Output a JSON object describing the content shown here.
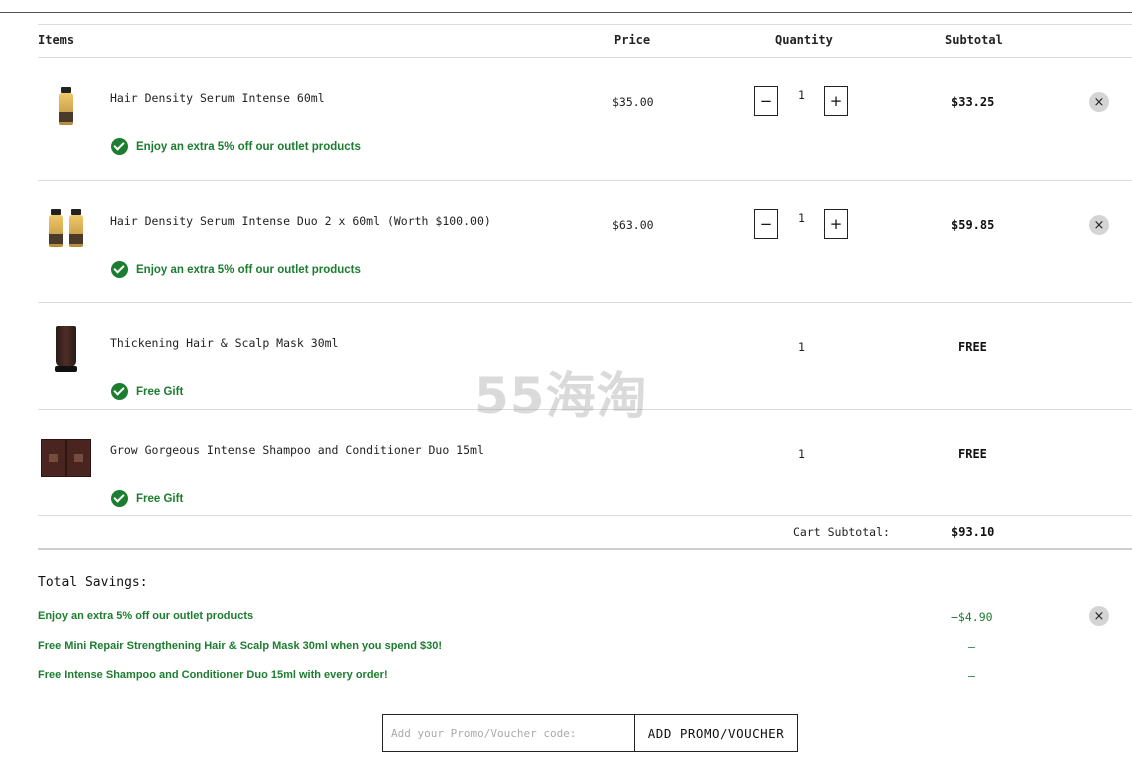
{
  "header": {
    "items": "Items",
    "price": "Price",
    "quantity": "Quantity",
    "subtotal": "Subtotal"
  },
  "items": [
    {
      "name": "Hair Density Serum Intense 60ml",
      "price": "$35.00",
      "quantity": "1",
      "subtotal": "$33.25",
      "promo": "Enjoy an extra 5% off our outlet products"
    },
    {
      "name": "Hair Density Serum Intense Duo 2 x 60ml (Worth $100.00)",
      "price": "$63.00",
      "quantity": "1",
      "subtotal": "$59.85",
      "promo": "Enjoy an extra 5% off our outlet products"
    },
    {
      "name": "Thickening Hair & Scalp Mask 30ml",
      "quantity": "1",
      "subtotal": "FREE",
      "promo": "Free Gift"
    },
    {
      "name": "Grow Gorgeous Intense Shampoo and Conditioner Duo 15ml",
      "quantity": "1",
      "subtotal": "FREE",
      "promo": "Free Gift"
    }
  ],
  "qty_controls": {
    "minus": "−",
    "plus": "+"
  },
  "remove_symbol": "×",
  "cart_subtotal": {
    "label": "Cart Subtotal:",
    "value": "$93.10"
  },
  "savings": {
    "title": "Total Savings:",
    "lines": [
      {
        "label": "Enjoy an extra 5% off our outlet products",
        "amount": "−$4.90"
      },
      {
        "label": "Free Mini Repair Strengthening Hair & Scalp Mask 30ml when you spend $30!",
        "amount": "–"
      },
      {
        "label": "Free Intense Shampoo and Conditioner Duo 15ml with every order!",
        "amount": "–"
      }
    ]
  },
  "promo_code": {
    "placeholder": "Add your Promo/Voucher code:",
    "button": "ADD PROMO/VOUCHER"
  },
  "watermark": "55海淘",
  "colors": {
    "accent_green": "#1c7d2f",
    "remove_bg": "#d4d4d4"
  }
}
